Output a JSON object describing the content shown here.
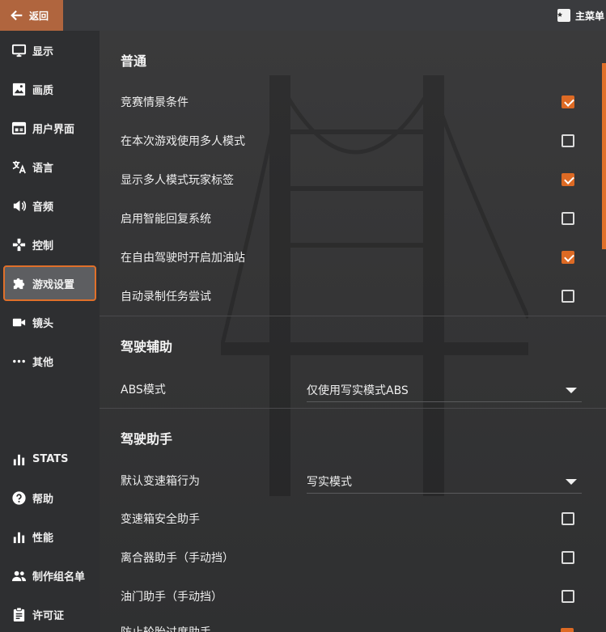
{
  "topbar": {
    "back_label": "返回",
    "main_menu_label": "主菜单"
  },
  "sidebar": {
    "items": [
      {
        "label": "显示",
        "icon": "monitor-icon"
      },
      {
        "label": "画质",
        "icon": "image-icon"
      },
      {
        "label": "用户界面",
        "icon": "ui-window-icon"
      },
      {
        "label": "语言",
        "icon": "translate-icon"
      },
      {
        "label": "音频",
        "icon": "speaker-icon"
      },
      {
        "label": "控制",
        "icon": "gamepad-icon"
      },
      {
        "label": "游戏设置",
        "icon": "puzzle-icon",
        "active": true
      },
      {
        "label": "镜头",
        "icon": "camera-icon"
      },
      {
        "label": "其他",
        "icon": "more-icon"
      }
    ],
    "bottom_items": [
      {
        "label": "STATS",
        "icon": "bar-chart-icon"
      },
      {
        "label": "帮助",
        "icon": "help-icon"
      },
      {
        "label": "性能",
        "icon": "bar-chart-icon"
      },
      {
        "label": "制作组名单",
        "icon": "people-icon"
      },
      {
        "label": "许可证",
        "icon": "license-icon"
      }
    ]
  },
  "sections": {
    "general": {
      "title": "普通",
      "rows": [
        {
          "label": "竞赛情景条件",
          "checked": true
        },
        {
          "label": "在本次游戏使用多人模式",
          "checked": false
        },
        {
          "label": "显示多人模式玩家标签",
          "checked": true
        },
        {
          "label": "启用智能回复系统",
          "checked": false
        },
        {
          "label": "在自由驾驶时开启加油站",
          "checked": true
        },
        {
          "label": "自动录制任务尝试",
          "checked": false
        }
      ]
    },
    "driving_aids": {
      "title": "驾驶辅助",
      "abs_label": "ABS模式",
      "abs_value": "仅使用写实模式ABS"
    },
    "driving_assist": {
      "title": "驾驶助手",
      "gearbox_label": "默认变速箱行为",
      "gearbox_value": "写实模式",
      "rows": [
        {
          "label": "变速箱安全助手",
          "checked": false
        },
        {
          "label": "离合器助手（手动挡）",
          "checked": false
        },
        {
          "label": "油门助手（手动挡）",
          "checked": false
        }
      ],
      "partial_label": "防止轮胎过度助手"
    }
  },
  "colors": {
    "accent": "#dd6a24",
    "back_button": "#b0653e",
    "sidebar_bg": "#2e2f31"
  }
}
